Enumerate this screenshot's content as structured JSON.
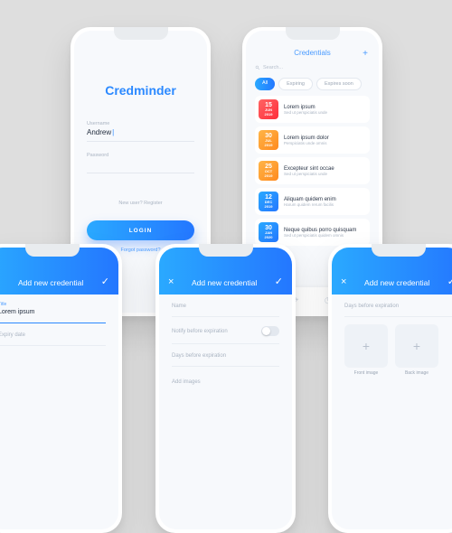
{
  "app_name": "Credminder",
  "login": {
    "username_label": "Username",
    "username_value": "Andrew",
    "password_label": "Password",
    "new_user": "New user? Register",
    "login_button": "LOGIN",
    "forgot": "Forgot password?"
  },
  "credentials": {
    "title": "Credentials",
    "search_placeholder": "Search...",
    "chips": {
      "all": "All",
      "expiring": "Expiring",
      "expires_soon": "Expires soon"
    },
    "items": [
      {
        "day": "15",
        "mon": "JUN",
        "year": "2019",
        "title": "Lorem ipsum",
        "sub": "Sed ut perspiciatis unde",
        "color": "c-red"
      },
      {
        "day": "30",
        "mon": "JUL",
        "year": "2019",
        "title": "Lorem ipsum dolor",
        "sub": "Perspiciatis unde omnis",
        "color": "c-org"
      },
      {
        "day": "25",
        "mon": "OCT",
        "year": "2019",
        "title": "Excepteur sint occae",
        "sub": "Sed ut perspiciatis unde",
        "color": "c-org"
      },
      {
        "day": "12",
        "mon": "DEC",
        "year": "2019",
        "title": "Aliquam quidem enim",
        "sub": "Harum quidem rerum facilis",
        "color": "c-blu"
      },
      {
        "day": "30",
        "mon": "JAN",
        "year": "2020",
        "title": "Neque quibus porro quisquam",
        "sub": "Sed ut perspiciatis quidem omnis",
        "color": "c-blu"
      }
    ]
  },
  "form": {
    "title": "Add new credential",
    "title_field_label": "Title",
    "title_field_value": "Lorem ipsum",
    "expiry_label": "Expiry date",
    "name_label": "Name",
    "notify_label": "Notify before expiration",
    "days_label": "Days before expiration",
    "add_images": "Add images",
    "front": "Front image",
    "back": "Back image"
  }
}
